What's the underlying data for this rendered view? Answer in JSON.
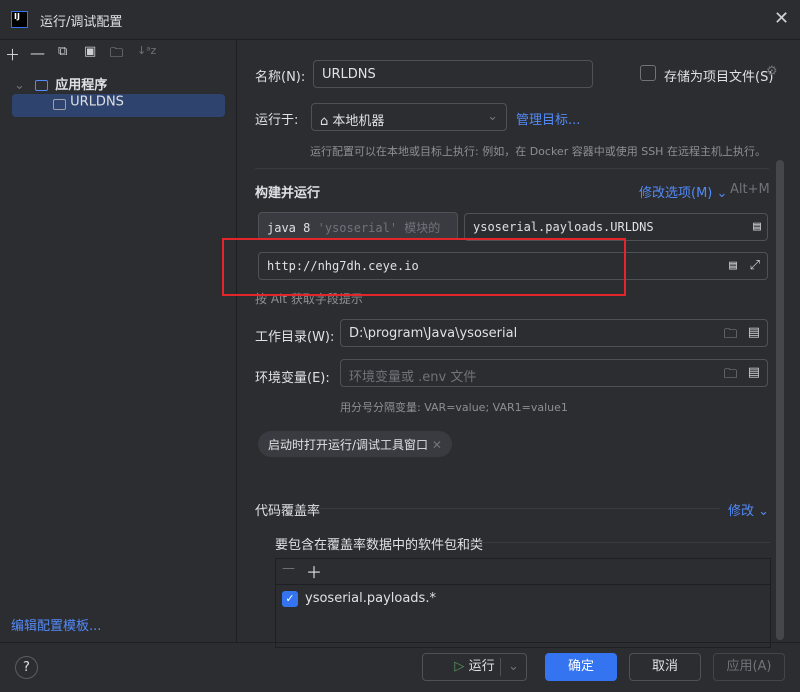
{
  "window": {
    "title": "运行/调试配置",
    "logo": "IJ"
  },
  "sidebar": {
    "group": "应用程序",
    "items": [
      {
        "label": "URLDNS"
      }
    ],
    "edit_templates": "编辑配置模板..."
  },
  "form": {
    "name_label": "名称(N):",
    "name_value": "URLDNS",
    "store_label": "存储为项目文件(S)",
    "run_on_label": "运行于:",
    "run_on_value": "本地机器",
    "manage_targets": "管理目标...",
    "run_on_hint": "运行配置可以在本地或目标上执行: 例如，在 Docker 容器中或使用 SSH 在远程主机上执行。",
    "build_run": "构建并运行",
    "modify_options": "修改选项(M)",
    "modify_shortcut": "Alt+M",
    "jdk": "java 8",
    "jdk_module": "'ysoserial' 模块的",
    "main_class": "ysoserial.payloads.URLDNS",
    "program_args": "http://nhg7dh.ceye.io",
    "alt_hint": "按 Alt 获取字段提示",
    "workdir_label": "工作目录(W):",
    "workdir_value": "D:\\program\\Java\\ysoserial",
    "env_label": "环境变量(E):",
    "env_placeholder": "环境变量或 .env 文件",
    "env_hint": "用分号分隔变量: VAR=value; VAR1=value1",
    "tag": "启动时打开运行/调试工具窗口",
    "coverage": "代码覆盖率",
    "coverage_modify": "修改",
    "coverage_packages": "要包含在覆盖率数据中的软件包和类",
    "coverage_items": [
      {
        "label": "ysoserial.payloads.*",
        "checked": true
      }
    ]
  },
  "footer": {
    "help": "?",
    "run": "运行",
    "ok": "确定",
    "cancel": "取消",
    "apply": "应用(A)"
  },
  "colors": {
    "accent": "#3574f0",
    "highlight_box": "#e3262b"
  }
}
